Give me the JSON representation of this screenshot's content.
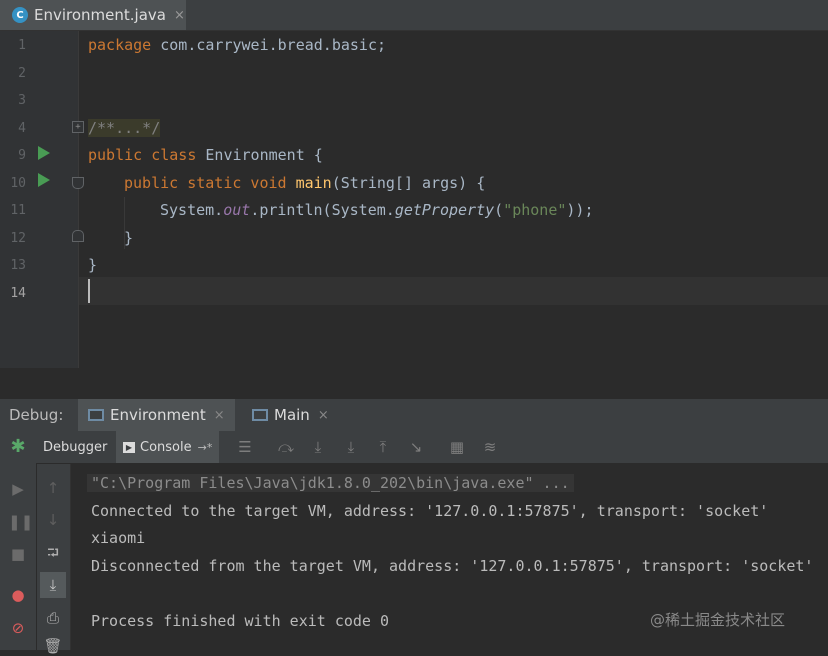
{
  "editor_tab": {
    "icon": "class-c-icon",
    "icon_glyph": "C",
    "title": "Environment.java",
    "close": "×"
  },
  "editor": {
    "line_numbers": [
      "1",
      "2",
      "3",
      "4",
      "9",
      "10",
      "11",
      "12",
      "13",
      "14"
    ],
    "lines": {
      "l1_kw": "package",
      "l1_rest": " com.carrywei.bread.basic;",
      "l4_comment": "/**...*/",
      "l9_kw": "public class",
      "l9_rest": " Environment {",
      "l10_kw": "public static void",
      "l10_fn": "main",
      "l10_rest": "(String[] args) {",
      "l11_a": "System.",
      "l11_static": "out",
      "l11_b": ".println(System.",
      "l11_method": "getProperty",
      "l11_c": "(",
      "l11_str": "\"phone\"",
      "l11_d": "));",
      "l12": "}",
      "l13": "}"
    }
  },
  "debug": {
    "title": "Debug:",
    "tabs": [
      {
        "label": "Environment",
        "close": "×"
      },
      {
        "label": "Main",
        "close": "×"
      }
    ],
    "subtabs": {
      "debugger": "Debugger",
      "console": "Console",
      "console_arrow": "→*"
    },
    "console_lines": [
      "\"C:\\Program Files\\Java\\jdk1.8.0_202\\bin\\java.exe\" ...",
      "Connected to the target VM, address: '127.0.0.1:57875', transport: 'socket'",
      "xiaomi",
      "Disconnected from the target VM, address: '127.0.0.1:57875', transport: 'socket'",
      "",
      "Process finished with exit code 0"
    ]
  },
  "watermark": "@稀土掘金技术社区",
  "colors": {
    "keyword": "#cc7832",
    "method": "#ffc66d",
    "static_field": "#9876aa",
    "string": "#6a8759",
    "background": "#2b2b2b"
  }
}
